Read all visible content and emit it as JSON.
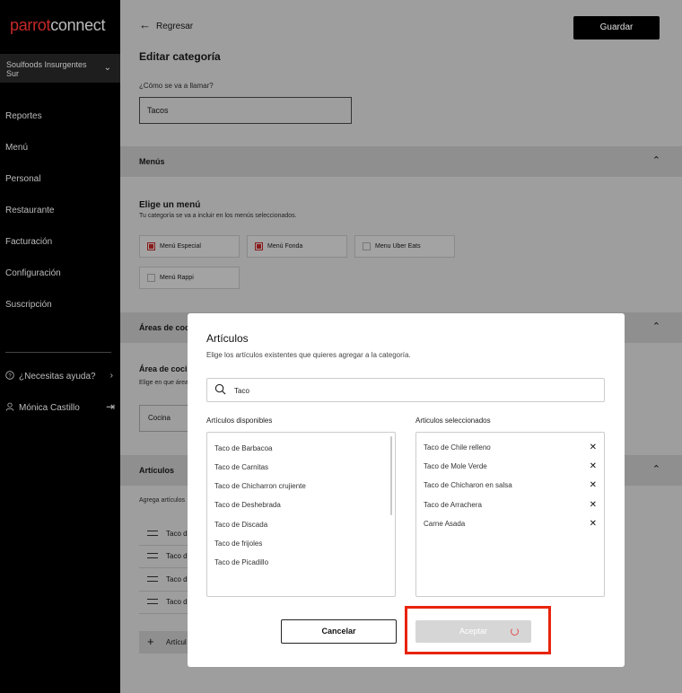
{
  "brand": {
    "logo_part1": "parrot",
    "logo_part2": "connect",
    "logo_accent": "#c62828"
  },
  "sidebar": {
    "store_name": "Soulfoods Insurgentes Sur",
    "items": [
      {
        "label": "Reportes"
      },
      {
        "label": "Menú"
      },
      {
        "label": "Personal"
      },
      {
        "label": "Restaurante"
      },
      {
        "label": "Facturación"
      },
      {
        "label": "Configuración"
      },
      {
        "label": "Suscripción"
      }
    ],
    "help_label": "¿Necesitas ayuda?",
    "user_name": "Mónica Castillo"
  },
  "header": {
    "back_label": "Regresar",
    "save_label": "Guardar"
  },
  "form": {
    "page_title": "Editar categoría",
    "name_label": "¿Cómo se va a llamar?",
    "name_value": "Tacos"
  },
  "menus_section": {
    "title": "Menús",
    "choose_title": "Elige un menú",
    "choose_desc": "Tu categoría se va a incluir en los menús seleccionados.",
    "options": [
      {
        "label": "Menú Especial",
        "checked": true
      },
      {
        "label": "Menú Fonda",
        "checked": true
      },
      {
        "label": "Menu Uber Eats",
        "checked": false
      },
      {
        "label": "Menú Rappi",
        "checked": false
      }
    ]
  },
  "areas_section": {
    "title": "Áreas de coc",
    "sub_title": "Área de coci",
    "sub_desc": "Elige en que área",
    "value": "Cocina"
  },
  "articles_section": {
    "title": "Artículos",
    "desc": "Agrega artículos",
    "rows": [
      "Taco d",
      "Taco d",
      "Taco d",
      "Taco d"
    ],
    "add_label": "Artícul"
  },
  "modal": {
    "title": "Artículos",
    "description": "Elige los artículos existentes que quieres agregar a la categoría.",
    "search_value": "Taco",
    "available_title": "Artículos disponibles",
    "available": [
      "Taco de Barbacoa",
      "Taco de Carnitas",
      "Taco de Chicharron crujiente",
      "Taco de Deshebrada",
      "Taco de Discada",
      "Taco de frijoles",
      "Taco de Picadillo"
    ],
    "selected_title": "Articulos seleccionados",
    "selected": [
      "Taco de Chile relleno",
      "Taco de Mole Verde",
      "Taco de Chicharon en salsa",
      "Taco de Arrachera",
      "Carne Asada"
    ],
    "cancel_label": "Cancelar",
    "accept_label": "Aceptar"
  }
}
